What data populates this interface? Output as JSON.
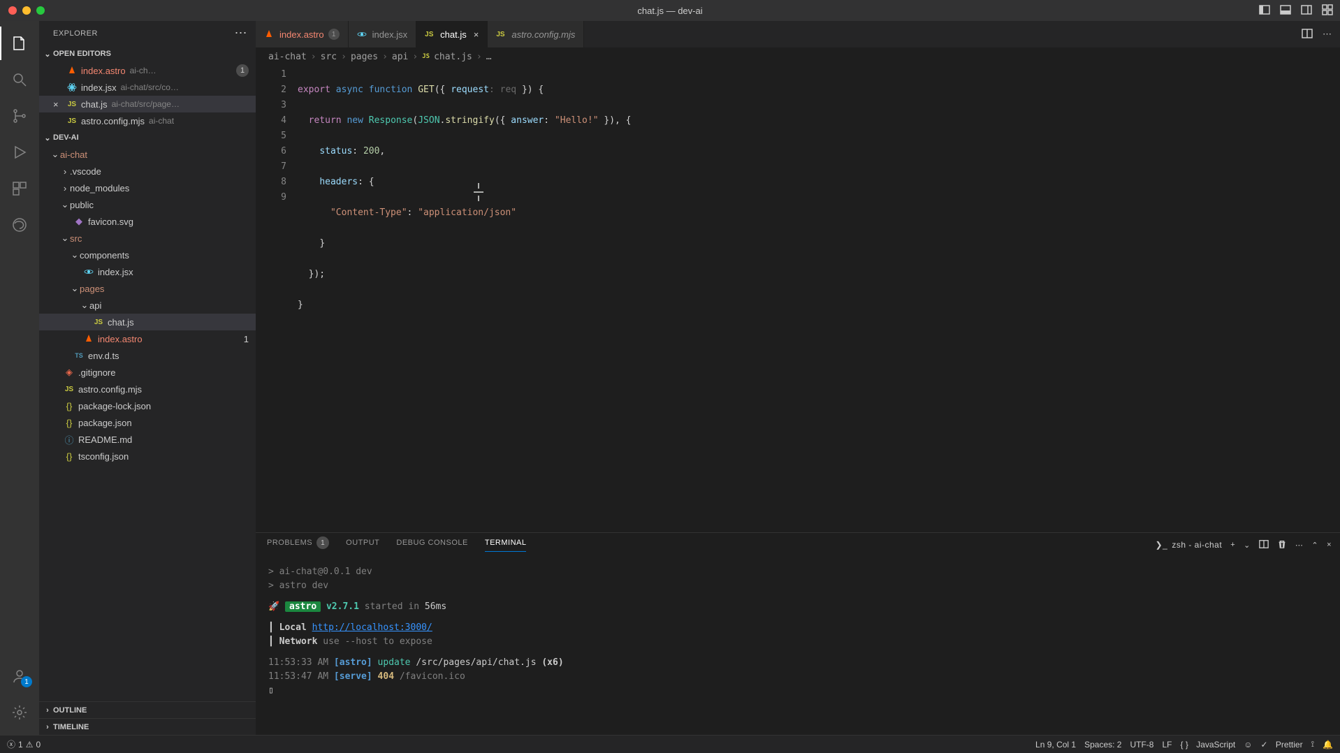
{
  "titlebar": {
    "title": "chat.js — dev-ai"
  },
  "explorer": {
    "title": "EXPLORER",
    "open_editors_label": "OPEN EDITORS",
    "project_label": "DEV-AI",
    "outline_label": "OUTLINE",
    "timeline_label": "TIMELINE",
    "open_editors": [
      {
        "name": "index.astro",
        "path": "ai-ch…",
        "icon": "astro",
        "badge": "1"
      },
      {
        "name": "index.jsx",
        "path": "ai-chat/src/co…",
        "icon": "jsx"
      },
      {
        "name": "chat.js",
        "path": "ai-chat/src/page…",
        "icon": "js",
        "active": true
      },
      {
        "name": "astro.config.mjs",
        "path": "ai-chat",
        "icon": "js"
      }
    ],
    "tree": {
      "ai_chat": "ai-chat",
      "vscode": ".vscode",
      "node_modules": "node_modules",
      "public": "public",
      "favicon": "favicon.svg",
      "src": "src",
      "components": "components",
      "index_jsx": "index.jsx",
      "pages": "pages",
      "api": "api",
      "chat_js": "chat.js",
      "index_astro": "index.astro",
      "index_astro_badge": "1",
      "env_d_ts": "env.d.ts",
      "gitignore": ".gitignore",
      "astro_config": "astro.config.mjs",
      "package_lock": "package-lock.json",
      "package_json": "package.json",
      "readme": "README.md",
      "tsconfig": "tsconfig.json"
    }
  },
  "tabs": [
    {
      "name": "index.astro",
      "icon": "astro",
      "badge": "1"
    },
    {
      "name": "index.jsx",
      "icon": "jsx"
    },
    {
      "name": "chat.js",
      "icon": "js",
      "active": true,
      "closable": true
    },
    {
      "name": "astro.config.mjs",
      "icon": "js",
      "italic": true
    }
  ],
  "breadcrumb": [
    "ai-chat",
    "src",
    "pages",
    "api",
    "chat.js",
    "…"
  ],
  "editor": {
    "lines": [
      "1",
      "2",
      "3",
      "4",
      "5",
      "6",
      "7",
      "8",
      "9"
    ],
    "code": {
      "l1_a": "export",
      "l1_b": "async",
      "l1_c": "function",
      "l1_d": "GET",
      "l1_e": "({",
      "l1_f": "request",
      "l1_g": ": req",
      "l1_h": "}) {",
      "l2_a": "return",
      "l2_b": "new",
      "l2_c": "Response",
      "l2_d": "(",
      "l2_e": "JSON",
      "l2_f": ".",
      "l2_g": "stringify",
      "l2_h": "({",
      "l2_i": "answer",
      "l2_j": ":",
      "l2_k": "\"Hello!\"",
      "l2_l": "}), {",
      "l3_a": "status",
      "l3_b": ":",
      "l3_c": "200",
      "l3_d": ",",
      "l4_a": "headers",
      "l4_b": ": {",
      "l5_a": "\"Content-Type\"",
      "l5_b": ":",
      "l5_c": "\"application/json\"",
      "l6": "}",
      "l7": "});",
      "l8": "}"
    }
  },
  "panel": {
    "tabs": {
      "problems": "PROBLEMS",
      "problems_count": "1",
      "output": "OUTPUT",
      "debug": "DEBUG CONSOLE",
      "terminal": "TERMINAL"
    },
    "term_name": "zsh - ai-chat",
    "output": {
      "l1": "> ai-chat@0.0.1 dev",
      "l2": "> astro dev",
      "astro_label": "astro",
      "astro_ver": "v2.7.1",
      "started": "started in",
      "ms": "56ms",
      "local_label": "Local",
      "local_url": "http://localhost:3000/",
      "network_label": "Network",
      "network_hint": "use --host to expose",
      "ts1": "11:53:33 AM",
      "tag1": "[astro]",
      "word_update": "update",
      "path1": "/src/pages/api/chat.js",
      "x6": "(x6)",
      "ts2": "11:53:47 AM",
      "tag2": "[serve]",
      "code_404": "404",
      "path2": "/favicon.ico",
      "prompt": "▯"
    }
  },
  "statusbar": {
    "errors": "1",
    "warnings": "0",
    "ln_col": "Ln 9, Col 1",
    "spaces": "Spaces: 2",
    "encoding": "UTF-8",
    "eol": "LF",
    "lang": "JavaScript",
    "prettier": "Prettier"
  },
  "activity_badge": "1"
}
